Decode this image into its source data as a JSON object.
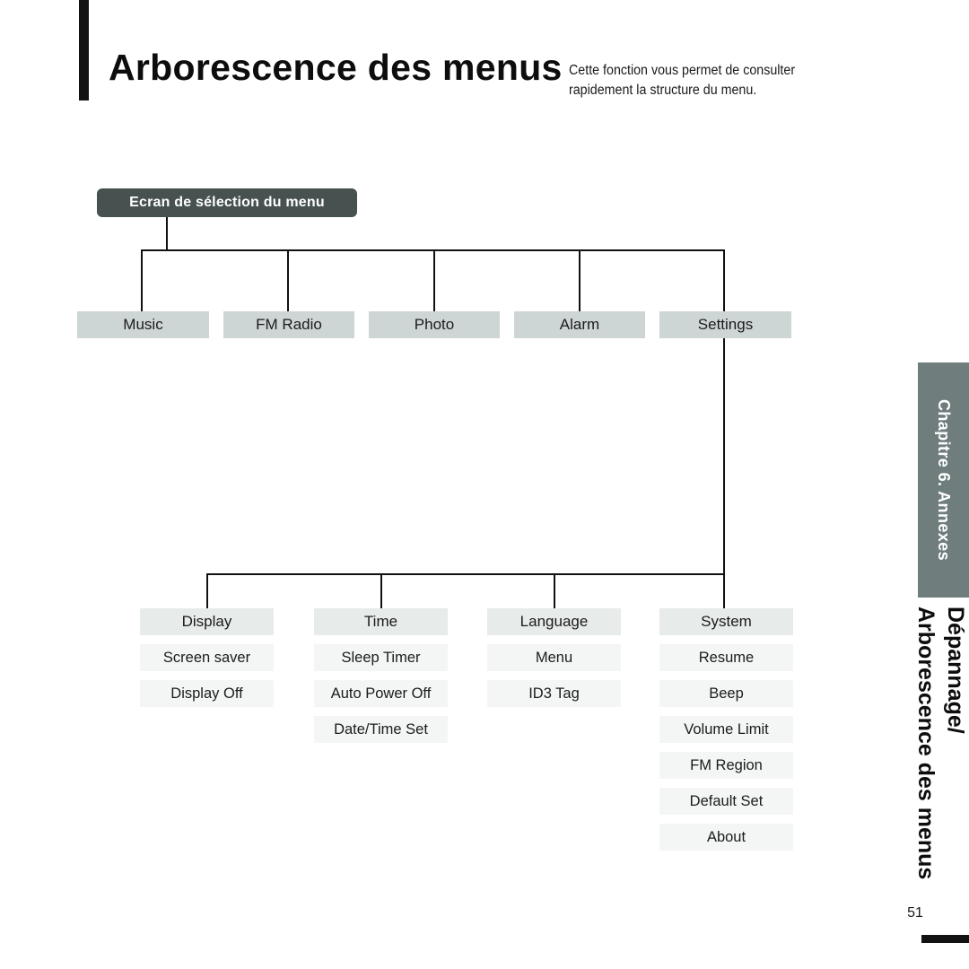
{
  "header": {
    "title": "Arborescence des menus",
    "subtitle_lines": [
      "Cette fonction vous permet de consulter",
      "rapidement la structure du menu."
    ]
  },
  "tree": {
    "root_label": "Ecran de sélection du menu",
    "level1": [
      {
        "label": "Music"
      },
      {
        "label": "FM Radio"
      },
      {
        "label": "Photo"
      },
      {
        "label": "Alarm"
      },
      {
        "label": "Settings"
      }
    ],
    "settings_columns": [
      {
        "header": "Display",
        "items": [
          "Screen saver",
          "Display Off"
        ]
      },
      {
        "header": "Time",
        "items": [
          "Sleep Timer",
          "Auto Power Off",
          "Date/Time Set"
        ]
      },
      {
        "header": "Language",
        "items": [
          "Menu",
          "ID3 Tag"
        ]
      },
      {
        "header": "System",
        "items": [
          "Resume",
          "Beep",
          "Volume Limit",
          "FM Region",
          "Default Set",
          "About"
        ]
      }
    ]
  },
  "sidebar": {
    "chapter_tab": "Chapitre 6.  Annexes",
    "section_lines": [
      "Dépannage/",
      "Arborescence des menus"
    ]
  },
  "footer": {
    "page_number": "51"
  },
  "colors": {
    "root_box": "#475150",
    "level1_box": "#ced5d5",
    "column_header": "#e7ebea",
    "column_item": "#f4f6f6",
    "chapter_tab": "#6f7d7d",
    "line": "#111111",
    "ink": "#0d0d0d"
  }
}
